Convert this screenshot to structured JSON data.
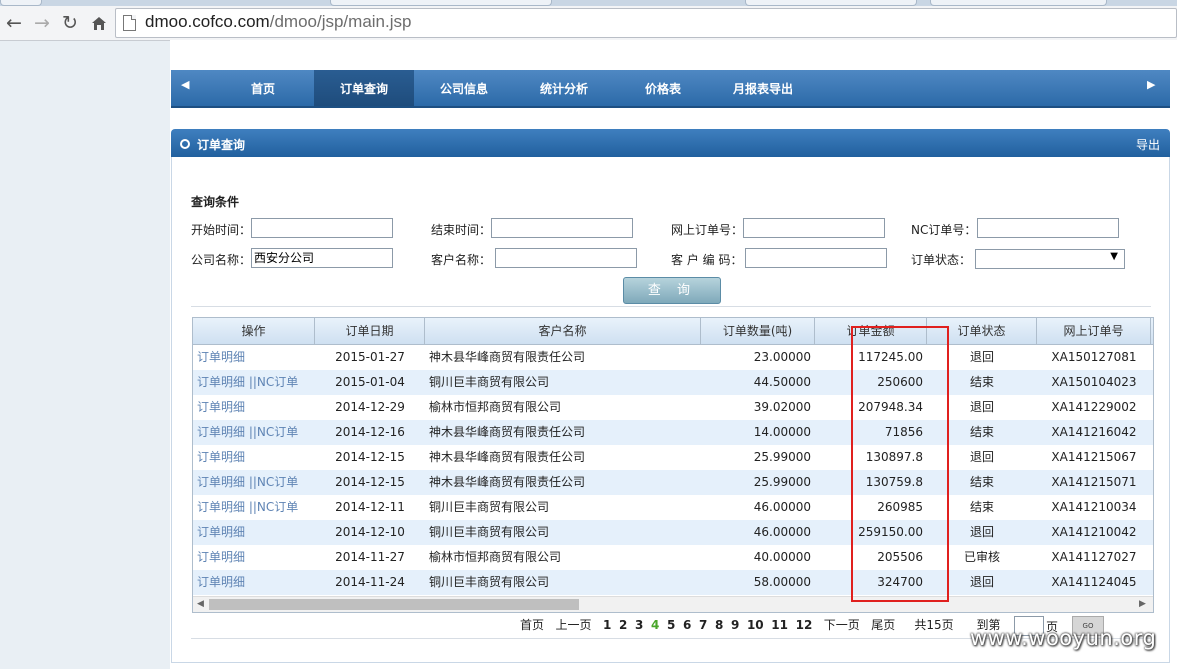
{
  "browser": {
    "url_host": "dmoo.cofco.com",
    "url_path": "/dmoo/jsp/main.jsp"
  },
  "nav": {
    "items": [
      {
        "label": "首页"
      },
      {
        "label": "订单查询"
      },
      {
        "label": "公司信息"
      },
      {
        "label": "统计分析"
      },
      {
        "label": "价格表"
      },
      {
        "label": "月报表导出"
      }
    ],
    "active_index": 1
  },
  "section": {
    "title": "订单查询",
    "export_label": "导出"
  },
  "query": {
    "title": "查询条件",
    "start_time_label": "开始时间：",
    "end_time_label": "结束时间：",
    "online_order_label": "网上订单号：",
    "nc_order_label": "NC订单号：",
    "company_label": "公司名称：",
    "company_value": "西安分公司",
    "customer_name_label": "客户名称：",
    "customer_code_label": "客 户 编 码：",
    "order_status_label": "订单状态：",
    "search_button": "查 询"
  },
  "table": {
    "headers": [
      "操作",
      "订单日期",
      "客户名称",
      "订单数量(吨)",
      "订单金额",
      "订单状态",
      "网上订单号"
    ],
    "rows": [
      {
        "op": "订单明细",
        "date": "2015-01-27",
        "customer": "神木县华峰商贸有限责任公司",
        "qty": "23.00000",
        "amount": "117245.00",
        "status": "退回",
        "order_no": "XA150127081"
      },
      {
        "op": "订单明细 ||NC订单",
        "date": "2015-01-04",
        "customer": "铜川巨丰商贸有限公司",
        "qty": "44.50000",
        "amount": "250600",
        "status": "结束",
        "order_no": "XA150104023"
      },
      {
        "op": "订单明细",
        "date": "2014-12-29",
        "customer": "榆林市恒邦商贸有限公司",
        "qty": "39.02000",
        "amount": "207948.34",
        "status": "退回",
        "order_no": "XA141229002"
      },
      {
        "op": "订单明细 ||NC订单",
        "date": "2014-12-16",
        "customer": "神木县华峰商贸有限责任公司",
        "qty": "14.00000",
        "amount": "71856",
        "status": "结束",
        "order_no": "XA141216042"
      },
      {
        "op": "订单明细",
        "date": "2014-12-15",
        "customer": "神木县华峰商贸有限责任公司",
        "qty": "25.99000",
        "amount": "130897.8",
        "status": "退回",
        "order_no": "XA141215067"
      },
      {
        "op": "订单明细 ||NC订单",
        "date": "2014-12-15",
        "customer": "神木县华峰商贸有限责任公司",
        "qty": "25.99000",
        "amount": "130759.8",
        "status": "结束",
        "order_no": "XA141215071"
      },
      {
        "op": "订单明细 ||NC订单",
        "date": "2014-12-11",
        "customer": "铜川巨丰商贸有限公司",
        "qty": "46.00000",
        "amount": "260985",
        "status": "结束",
        "order_no": "XA141210034"
      },
      {
        "op": "订单明细",
        "date": "2014-12-10",
        "customer": "铜川巨丰商贸有限公司",
        "qty": "46.00000",
        "amount": "259150.00",
        "status": "退回",
        "order_no": "XA141210042"
      },
      {
        "op": "订单明细",
        "date": "2014-11-27",
        "customer": "榆林市恒邦商贸有限公司",
        "qty": "40.00000",
        "amount": "205506",
        "status": "已审核",
        "order_no": "XA141127027"
      },
      {
        "op": "订单明细",
        "date": "2014-11-24",
        "customer": "铜川巨丰商贸有限公司",
        "qty": "58.00000",
        "amount": "324700",
        "status": "退回",
        "order_no": "XA141124045"
      }
    ]
  },
  "pager": {
    "first": "首页",
    "prev": "上一页",
    "pages": [
      "1",
      "2",
      "3",
      "4",
      "5",
      "6",
      "7",
      "8",
      "9",
      "10",
      "11",
      "12"
    ],
    "current": "4",
    "next": "下一页",
    "last": "尾页",
    "total": "共15页",
    "goto_prefix": "到第",
    "goto_suffix": "页",
    "go_button": "GO"
  },
  "watermark": "www.wooyun.org",
  "colors": {
    "nav_blue": "#2c6aa8",
    "link": "#5f84b4",
    "highlight_box": "#e0201e",
    "current_page": "#4aa62a"
  }
}
